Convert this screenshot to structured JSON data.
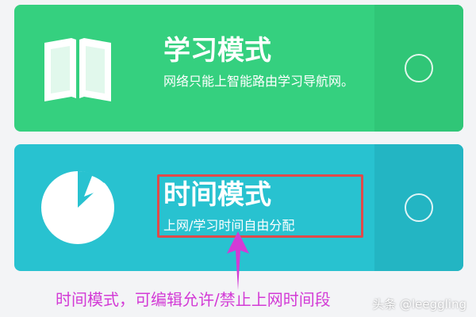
{
  "colors": {
    "learning_card": "#35d07f",
    "time_card": "#28c2d0",
    "highlight": "#e04a4a",
    "annotation": "#d33bd6"
  },
  "modes": {
    "learning": {
      "title": "学习模式",
      "description": "网络只能上智能路由学习导航网。",
      "icon": "open-book-icon",
      "selector_icon": "radio-circle-icon"
    },
    "time": {
      "title": "时间模式",
      "description": "上网/学习时间自由分配",
      "icon": "pie-chart-icon",
      "selector_icon": "radio-circle-icon"
    }
  },
  "annotation": {
    "text": "时间模式，可编辑允许/禁止上网时间段",
    "arrow_icon": "up-arrow-icon"
  },
  "watermark": {
    "text": "头条 @leeggling"
  }
}
